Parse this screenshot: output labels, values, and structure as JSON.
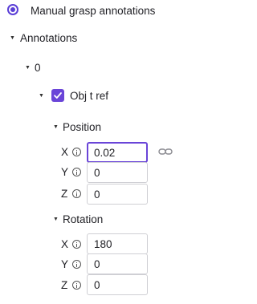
{
  "manual_grasp": {
    "label": "Manual grasp annotations",
    "selected": true
  },
  "tree": {
    "annotations_label": "Annotations",
    "index_label": "0",
    "obj_ref": {
      "label": "Obj t ref",
      "checked": true
    },
    "position": {
      "label": "Position",
      "x": {
        "axis": "X",
        "value": "0.02"
      },
      "y": {
        "axis": "Y",
        "value": "0"
      },
      "z": {
        "axis": "Z",
        "value": "0"
      }
    },
    "rotation": {
      "label": "Rotation",
      "x": {
        "axis": "X",
        "value": "180"
      },
      "y": {
        "axis": "Y",
        "value": "0"
      },
      "z": {
        "axis": "Z",
        "value": "0"
      }
    }
  },
  "colors": {
    "accent": "#6a45d8",
    "field_border": "#cfcfd4"
  },
  "icons": [
    "radio-selected",
    "caret-down-icon",
    "checkbox-checked",
    "info-icon",
    "link-icon"
  ]
}
